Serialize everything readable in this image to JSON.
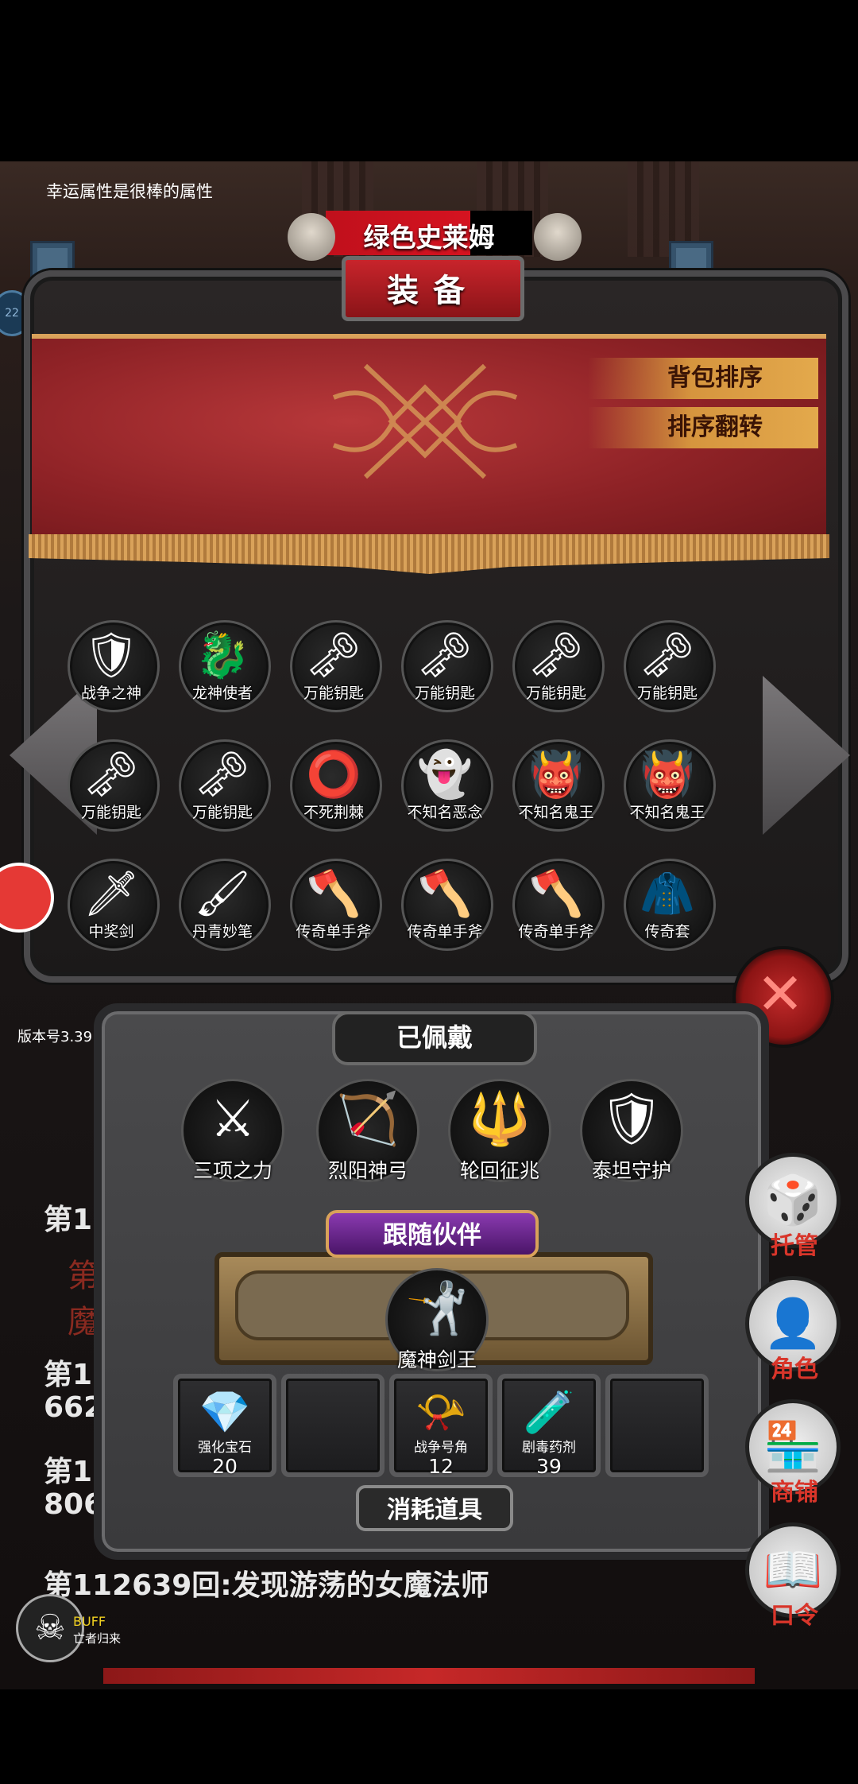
{
  "hint_text": "幸运属性是很棒的属性",
  "header": {
    "monster_name": "绿色史莱姆",
    "tab": "装备"
  },
  "banner": {
    "sort_bag": "背包排序",
    "sort_reverse": "排序翻转"
  },
  "inventory": [
    {
      "label": "战争之神",
      "icon": "war-god-icon",
      "glyph": "🛡"
    },
    {
      "label": "龙神使者",
      "icon": "dragon-messenger-icon",
      "glyph": "🐉"
    },
    {
      "label": "万能钥匙",
      "icon": "key-icon",
      "glyph": "🗝"
    },
    {
      "label": "万能钥匙",
      "icon": "key-icon",
      "glyph": "🗝"
    },
    {
      "label": "万能钥匙",
      "icon": "key-icon",
      "glyph": "🗝"
    },
    {
      "label": "万能钥匙",
      "icon": "key-icon",
      "glyph": "🗝"
    },
    {
      "label": "万能钥匙",
      "icon": "key-icon",
      "glyph": "🗝"
    },
    {
      "label": "万能钥匙",
      "icon": "key-icon",
      "glyph": "🗝"
    },
    {
      "label": "不死荆棘",
      "icon": "thorn-wreath-icon",
      "glyph": "⭕"
    },
    {
      "label": "不知名恶念",
      "icon": "ghost-icon",
      "glyph": "👻"
    },
    {
      "label": "不知名鬼王",
      "icon": "demon-king-icon",
      "glyph": "👹"
    },
    {
      "label": "不知名鬼王",
      "icon": "demon-king-icon",
      "glyph": "👹"
    },
    {
      "label": "中奖剑",
      "icon": "sword-icon",
      "glyph": "🗡"
    },
    {
      "label": "丹青妙笔",
      "icon": "brush-icon",
      "glyph": "🖌"
    },
    {
      "label": "传奇单手斧",
      "icon": "axe-icon",
      "glyph": "🪓"
    },
    {
      "label": "传奇单手斧",
      "icon": "axe-icon",
      "glyph": "🪓"
    },
    {
      "label": "传奇单手斧",
      "icon": "axe-icon",
      "glyph": "🪓"
    },
    {
      "label": "传奇套",
      "icon": "red-robe-icon",
      "glyph": "🧥"
    }
  ],
  "version": "版本号3.39",
  "equipped": {
    "title": "已佩戴",
    "items": [
      {
        "label": "三项之力",
        "icon": "triple-weapon-icon",
        "glyph": "⚔"
      },
      {
        "label": "烈阳神弓",
        "icon": "bow-icon",
        "glyph": "🏹"
      },
      {
        "label": "轮回征兆",
        "icon": "staff-icon",
        "glyph": "🔱"
      },
      {
        "label": "泰坦守护",
        "icon": "titan-armor-icon",
        "glyph": "🛡"
      }
    ]
  },
  "companion": {
    "title": "跟随伙伴",
    "label": "魔神剑王",
    "icon": "demon-sword-king-icon",
    "glyph": "🤺"
  },
  "consumables": {
    "title": "消耗道具",
    "slots": [
      {
        "label": "强化宝石",
        "count": "20",
        "icon": "gem-icon",
        "glyph": "💎"
      },
      {
        "label": "",
        "count": "",
        "icon": "",
        "glyph": ""
      },
      {
        "label": "战争号角",
        "count": "12",
        "icon": "horn-icon",
        "glyph": "📯"
      },
      {
        "label": "剧毒药剂",
        "count": "39",
        "icon": "poison-icon",
        "glyph": "🧪"
      },
      {
        "label": "",
        "count": "",
        "icon": "",
        "glyph": ""
      }
    ]
  },
  "log": {
    "line_a": "第1",
    "line_b_red": "第",
    "line_c_red": "魔",
    "line_d": "第11",
    "line_e": "662",
    "line_f": "第11",
    "line_g": "806",
    "line_h": "第112639回:发现游荡的女魔法师"
  },
  "side_menu": [
    {
      "label": "托管",
      "icon": "dice-icon",
      "glyph": "🎲"
    },
    {
      "label": "角色",
      "icon": "character-icon",
      "glyph": "👤"
    },
    {
      "label": "商铺",
      "icon": "shop-icon",
      "glyph": "🏪"
    },
    {
      "label": "口令",
      "icon": "code-book-icon",
      "glyph": "📖"
    }
  ],
  "buff": {
    "title": "BUFF",
    "subtitle": "亡者归来"
  },
  "left_bubble": "22"
}
